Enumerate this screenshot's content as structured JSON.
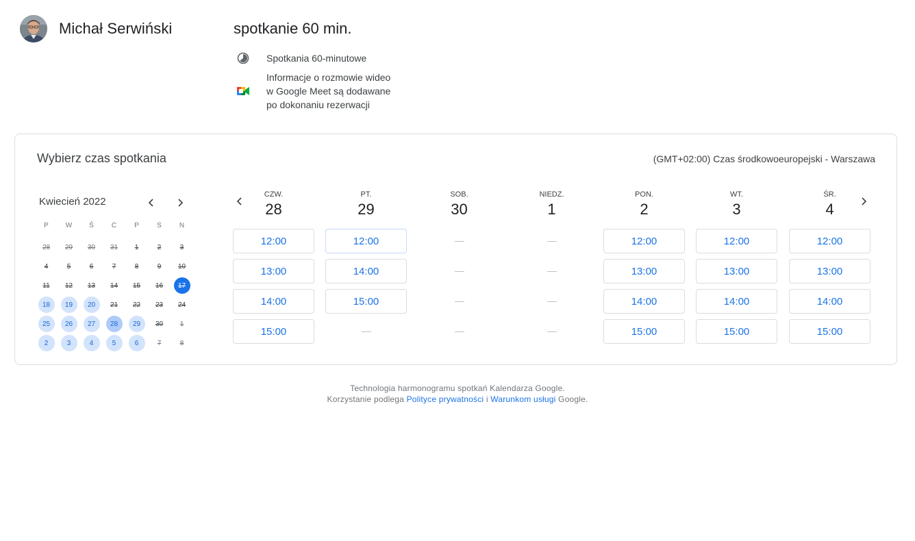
{
  "owner": {
    "name": "Michał Serwiński"
  },
  "event": {
    "title": "spotkanie 60 min.",
    "duration": "Spotkania 60-minutowe",
    "video_info_lines": [
      "Informacje o rozmowie wideo",
      "w Google Meet są dodawane",
      "po dokonaniu rezerwacji"
    ]
  },
  "card": {
    "title": "Wybierz czas spotkania",
    "timezone": "(GMT+02:00) Czas środkowoeuropejski - Warszawa"
  },
  "mini_calendar": {
    "month": "Kwiecień 2022",
    "weekdays": [
      "P",
      "W",
      "Ś",
      "C",
      "P",
      "S",
      "N"
    ],
    "weeks": [
      [
        {
          "d": "28",
          "s": "other"
        },
        {
          "d": "29",
          "s": "other"
        },
        {
          "d": "30",
          "s": "other"
        },
        {
          "d": "31",
          "s": "other"
        },
        {
          "d": "1",
          "s": "past"
        },
        {
          "d": "2",
          "s": "past"
        },
        {
          "d": "3",
          "s": "past"
        }
      ],
      [
        {
          "d": "4",
          "s": "past"
        },
        {
          "d": "5",
          "s": "past"
        },
        {
          "d": "6",
          "s": "past"
        },
        {
          "d": "7",
          "s": "past"
        },
        {
          "d": "8",
          "s": "past"
        },
        {
          "d": "9",
          "s": "past"
        },
        {
          "d": "10",
          "s": "past"
        }
      ],
      [
        {
          "d": "11",
          "s": "past"
        },
        {
          "d": "12",
          "s": "past"
        },
        {
          "d": "13",
          "s": "past"
        },
        {
          "d": "14",
          "s": "past"
        },
        {
          "d": "15",
          "s": "past"
        },
        {
          "d": "16",
          "s": "past"
        },
        {
          "d": "17",
          "s": "today"
        }
      ],
      [
        {
          "d": "18",
          "s": "avail"
        },
        {
          "d": "19",
          "s": "avail"
        },
        {
          "d": "20",
          "s": "avail"
        },
        {
          "d": "21",
          "s": "past"
        },
        {
          "d": "22",
          "s": "past"
        },
        {
          "d": "23",
          "s": "past"
        },
        {
          "d": "24",
          "s": "past"
        }
      ],
      [
        {
          "d": "25",
          "s": "avail"
        },
        {
          "d": "26",
          "s": "avail"
        },
        {
          "d": "27",
          "s": "avail"
        },
        {
          "d": "28",
          "s": "week"
        },
        {
          "d": "29",
          "s": "avail"
        },
        {
          "d": "30",
          "s": "past"
        },
        {
          "d": "1",
          "s": "other"
        }
      ],
      [
        {
          "d": "2",
          "s": "avail"
        },
        {
          "d": "3",
          "s": "avail"
        },
        {
          "d": "4",
          "s": "avail"
        },
        {
          "d": "5",
          "s": "avail"
        },
        {
          "d": "6",
          "s": "avail"
        },
        {
          "d": "7",
          "s": "other"
        },
        {
          "d": "8",
          "s": "other"
        }
      ]
    ]
  },
  "week": {
    "days": [
      {
        "weekday": "CZW.",
        "date": "28",
        "slots": [
          "12:00",
          "13:00",
          "14:00",
          "15:00"
        ]
      },
      {
        "weekday": "PT.",
        "date": "29",
        "slots": [
          "12:00",
          "14:00",
          "15:00"
        ]
      },
      {
        "weekday": "SOB.",
        "date": "30",
        "slots": []
      },
      {
        "weekday": "NIEDZ.",
        "date": "1",
        "slots": []
      },
      {
        "weekday": "PON.",
        "date": "2",
        "slots": [
          "12:00",
          "13:00",
          "14:00",
          "15:00"
        ]
      },
      {
        "weekday": "WT.",
        "date": "3",
        "slots": [
          "12:00",
          "13:00",
          "14:00",
          "15:00"
        ]
      },
      {
        "weekday": "ŚR.",
        "date": "4",
        "slots": [
          "12:00",
          "13:00",
          "14:00",
          "15:00"
        ]
      }
    ]
  },
  "footer": {
    "line1": "Technologia harmonogramu spotkań Kalendarza Google.",
    "line2_prefix": "Korzystanie podlega ",
    "privacy_link": "Polityce prywatności",
    "and": " i ",
    "terms_link": "Warunkom usługi",
    "line2_suffix": " Google."
  },
  "colors": {
    "accent": "#1a73e8",
    "available_day": "#d2e3fc",
    "selected_week": "#aecbfa",
    "border": "#dadce0"
  },
  "icons": [
    "avatar-photo",
    "clock-icon",
    "google-meet-icon",
    "chevron-left-icon",
    "chevron-right-icon"
  ]
}
